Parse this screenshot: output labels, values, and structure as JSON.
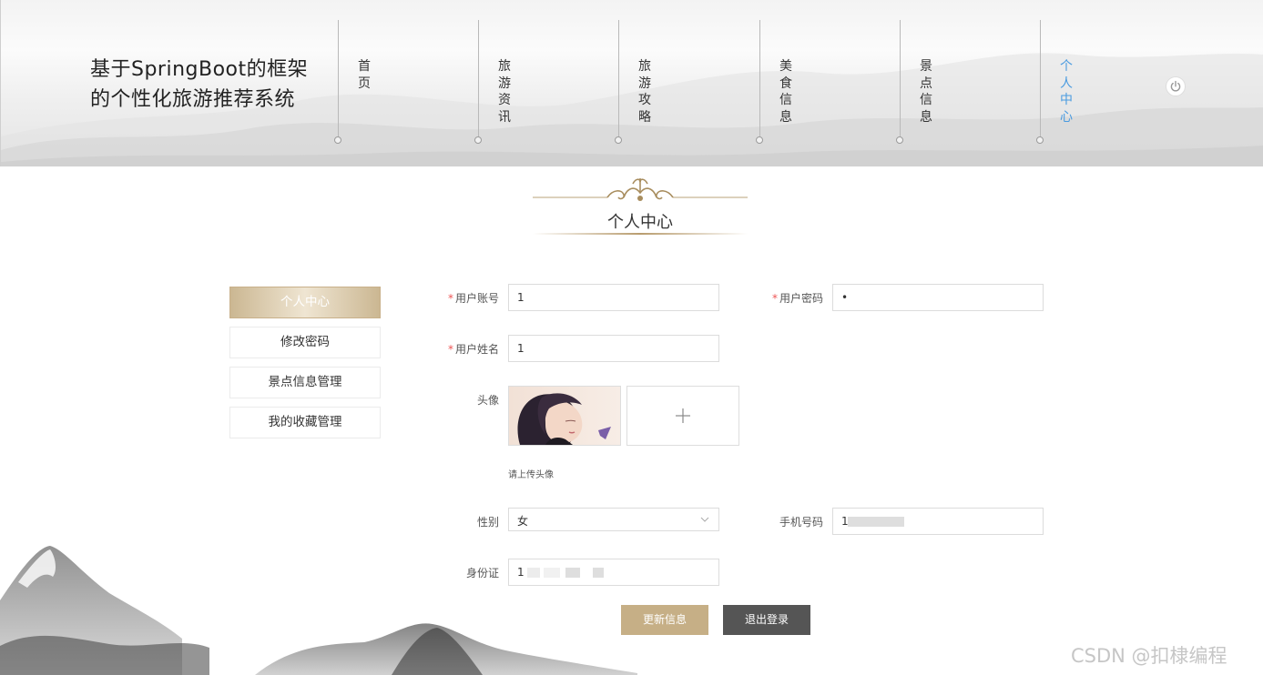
{
  "site": {
    "title": "基于SpringBoot的框架的个性化旅游推荐系统"
  },
  "nav": {
    "items": [
      {
        "label": "首页"
      },
      {
        "label": "旅游资讯"
      },
      {
        "label": "旅游攻略"
      },
      {
        "label": "美食信息"
      },
      {
        "label": "景点信息"
      },
      {
        "label": "个人中心"
      }
    ],
    "active_color": "#4a9be0"
  },
  "page": {
    "section_title": "个人中心"
  },
  "side_menu": {
    "items": [
      {
        "label": "个人中心"
      },
      {
        "label": "修改密码"
      },
      {
        "label": "景点信息管理"
      },
      {
        "label": "我的收藏管理"
      }
    ]
  },
  "form": {
    "required_mark": "*",
    "account": {
      "label": "用户账号",
      "value": "1"
    },
    "password": {
      "label": "用户密码",
      "value": "•"
    },
    "name": {
      "label": "用户姓名",
      "value": "1"
    },
    "avatar": {
      "label": "头像",
      "hint": "请上传头像",
      "add_icon": "plus-icon"
    },
    "gender": {
      "label": "性别",
      "value": "女"
    },
    "phone": {
      "label": "手机号码",
      "value": "1"
    },
    "id_card": {
      "label": "身份证",
      "value": "1"
    }
  },
  "buttons": {
    "update": "更新信息",
    "logout": "退出登录"
  },
  "watermark": "CSDN @扣棣编程",
  "colors": {
    "accent_gold": "#c6af86",
    "dark_button": "#555555"
  }
}
